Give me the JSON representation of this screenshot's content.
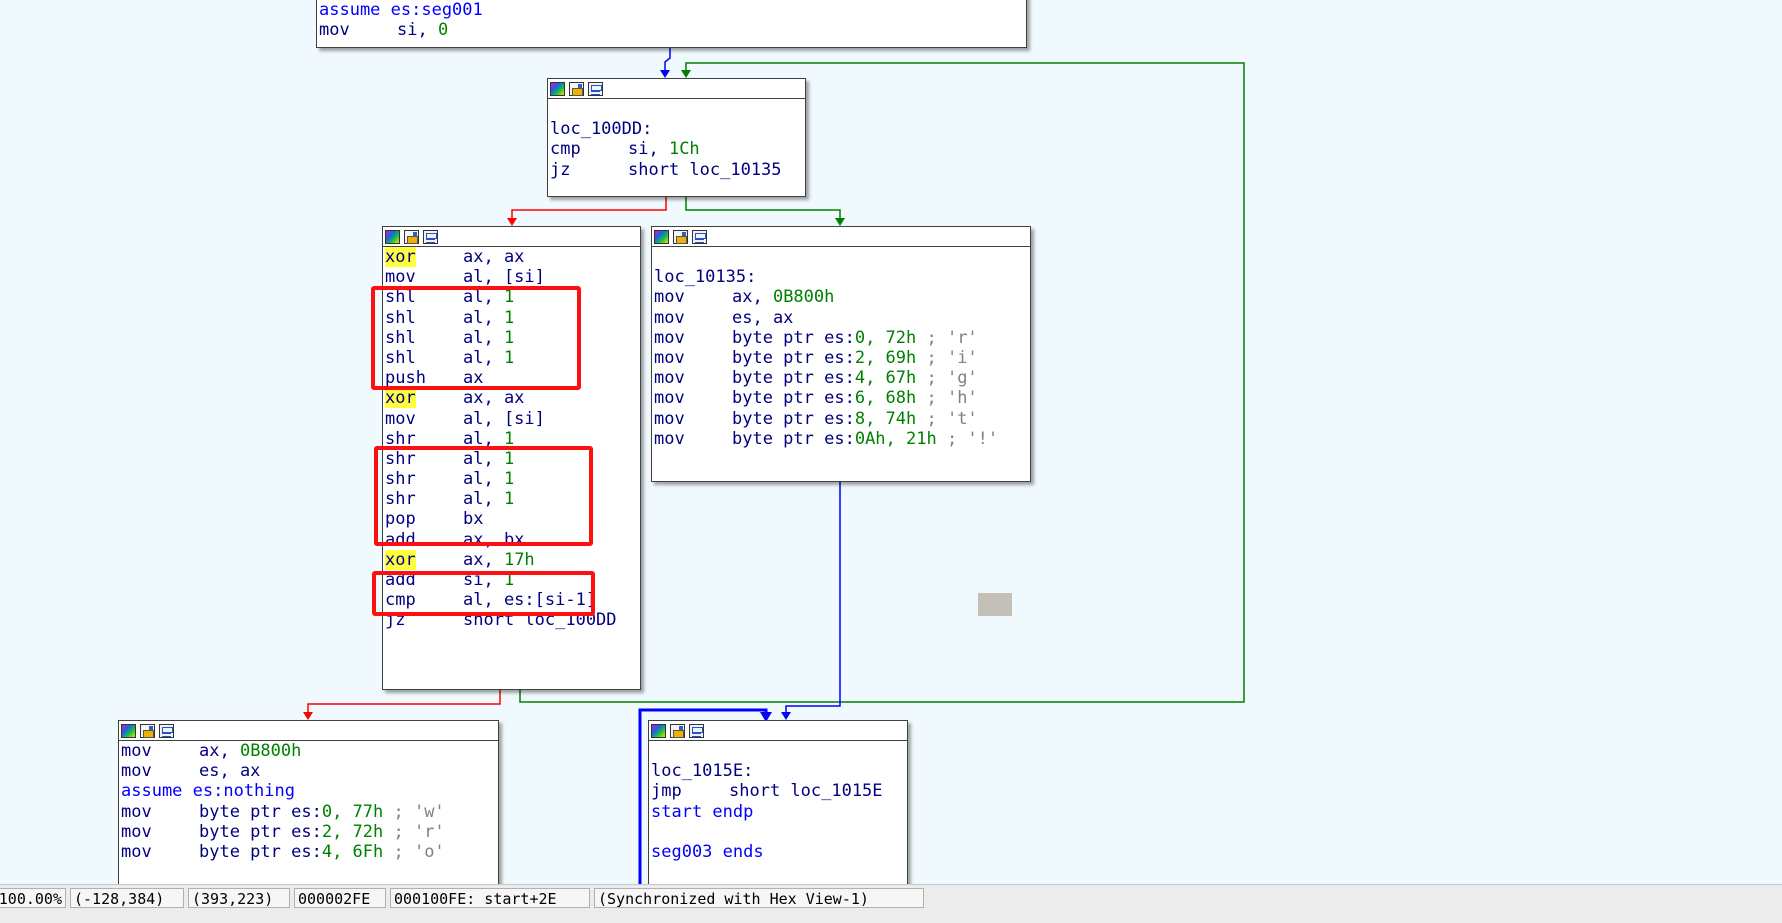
{
  "colors": {
    "background": "#f0f9fd",
    "edge_true": "#008000",
    "edge_false": "#ff0000",
    "edge_uncond": "#0000ff",
    "highlight": "#ffff40",
    "annotation": "#ff1010"
  },
  "node_icons": [
    "color-palette-icon",
    "edit-node-icon",
    "graph-overview-icon"
  ],
  "nodes": {
    "top": {
      "lines": [
        {
          "type": "kw",
          "text": "assume es:seg001"
        },
        {
          "type": "ins",
          "mn": "mov",
          "ops": "si, ",
          "num": "0",
          "cmt": ""
        }
      ]
    },
    "loop_head": {
      "lines": [
        {
          "type": "blank"
        },
        {
          "type": "label",
          "text": "loc_100DD:"
        },
        {
          "type": "ins",
          "mn": "cmp",
          "ops": "si, ",
          "num": "1Ch",
          "cmt": ""
        },
        {
          "type": "ins",
          "mn": "jz",
          "ops": "short loc_10135",
          "num": "",
          "cmt": ""
        }
      ]
    },
    "body": {
      "lines": [
        {
          "type": "ins",
          "mn": "xor",
          "hl": true,
          "ops": "ax, ax",
          "num": "",
          "cmt": ""
        },
        {
          "type": "ins",
          "mn": "mov",
          "ops": "al, [si]",
          "num": "",
          "cmt": ""
        },
        {
          "type": "ins",
          "mn": "shl",
          "ops": "al, ",
          "num": "1",
          "cmt": ""
        },
        {
          "type": "ins",
          "mn": "shl",
          "ops": "al, ",
          "num": "1",
          "cmt": ""
        },
        {
          "type": "ins",
          "mn": "shl",
          "ops": "al, ",
          "num": "1",
          "cmt": ""
        },
        {
          "type": "ins",
          "mn": "shl",
          "ops": "al, ",
          "num": "1",
          "cmt": ""
        },
        {
          "type": "ins",
          "mn": "push",
          "ops": "ax",
          "num": "",
          "cmt": ""
        },
        {
          "type": "ins",
          "mn": "xor",
          "hl": true,
          "ops": "ax, ax",
          "num": "",
          "cmt": ""
        },
        {
          "type": "ins",
          "mn": "mov",
          "ops": "al, [si]",
          "num": "",
          "cmt": ""
        },
        {
          "type": "ins",
          "mn": "shr",
          "ops": "al, ",
          "num": "1",
          "cmt": ""
        },
        {
          "type": "ins",
          "mn": "shr",
          "ops": "al, ",
          "num": "1",
          "cmt": ""
        },
        {
          "type": "ins",
          "mn": "shr",
          "ops": "al, ",
          "num": "1",
          "cmt": ""
        },
        {
          "type": "ins",
          "mn": "shr",
          "ops": "al, ",
          "num": "1",
          "cmt": ""
        },
        {
          "type": "ins",
          "mn": "pop",
          "ops": "bx",
          "num": "",
          "cmt": ""
        },
        {
          "type": "ins",
          "mn": "add",
          "ops": "ax, bx",
          "num": "",
          "cmt": ""
        },
        {
          "type": "ins",
          "mn": "xor",
          "hl": true,
          "ops": "ax, ",
          "num": "17h",
          "cmt": ""
        },
        {
          "type": "ins",
          "mn": "add",
          "ops": "si, ",
          "num": "1",
          "cmt": ""
        },
        {
          "type": "ins",
          "mn": "cmp",
          "ops": "al, es:[si-1]",
          "num": "",
          "cmt": ""
        },
        {
          "type": "ins",
          "mn": "jz",
          "ops": "short loc_100DD",
          "num": "",
          "cmt": ""
        }
      ]
    },
    "right_success": {
      "lines": [
        {
          "type": "blank"
        },
        {
          "type": "label",
          "text": "loc_10135:"
        },
        {
          "type": "ins",
          "mn": "mov",
          "ops": "ax, ",
          "num": "0B800h",
          "cmt": ""
        },
        {
          "type": "ins",
          "mn": "mov",
          "ops": "es, ax",
          "num": "",
          "cmt": ""
        },
        {
          "type": "ins",
          "mn": "mov",
          "ops": "byte ptr es:",
          "num": "0, 72h",
          "cmt": " ; 'r'"
        },
        {
          "type": "ins",
          "mn": "mov",
          "ops": "byte ptr es:",
          "num": "2, 69h",
          "cmt": " ; 'i'"
        },
        {
          "type": "ins",
          "mn": "mov",
          "ops": "byte ptr es:",
          "num": "4, 67h",
          "cmt": " ; 'g'"
        },
        {
          "type": "ins",
          "mn": "mov",
          "ops": "byte ptr es:",
          "num": "6, 68h",
          "cmt": " ; 'h'"
        },
        {
          "type": "ins",
          "mn": "mov",
          "ops": "byte ptr es:",
          "num": "8, 74h",
          "cmt": " ; 't'"
        },
        {
          "type": "ins",
          "mn": "mov",
          "ops": "byte ptr es:",
          "num": "0Ah, 21h",
          "cmt": " ; '!'"
        }
      ]
    },
    "bottom_left": {
      "lines": [
        {
          "type": "ins",
          "mn": "mov",
          "ops": "ax, ",
          "num": "0B800h",
          "cmt": ""
        },
        {
          "type": "ins",
          "mn": "mov",
          "ops": "es, ax",
          "num": "",
          "cmt": ""
        },
        {
          "type": "kw",
          "text": "assume es:nothing"
        },
        {
          "type": "ins",
          "mn": "mov",
          "ops": "byte ptr es:",
          "num": "0, 77h",
          "cmt": " ; 'w'"
        },
        {
          "type": "ins",
          "mn": "mov",
          "ops": "byte ptr es:",
          "num": "2, 72h",
          "cmt": " ; 'r'"
        },
        {
          "type": "ins",
          "mn": "mov",
          "ops": "byte ptr es:",
          "num": "4, 6Fh",
          "cmt": " ; 'o'"
        }
      ]
    },
    "bottom_right": {
      "lines": [
        {
          "type": "blank"
        },
        {
          "type": "label",
          "text": "loc_1015E:"
        },
        {
          "type": "ins",
          "mn": "jmp",
          "ops": "short loc_1015E",
          "num": "",
          "cmt": ""
        },
        {
          "type": "kw",
          "text": "start endp"
        },
        {
          "type": "blank"
        },
        {
          "type": "kw",
          "text": "seg003 ends"
        }
      ]
    }
  },
  "status": {
    "zoom": "100.00%",
    "graph_pos": "(-128,384)",
    "mouse_pos": "(393,223)",
    "file_offset": "000002FE",
    "address": "000100FE: start+2E",
    "sync": "(Synchronized with Hex View-1)"
  }
}
